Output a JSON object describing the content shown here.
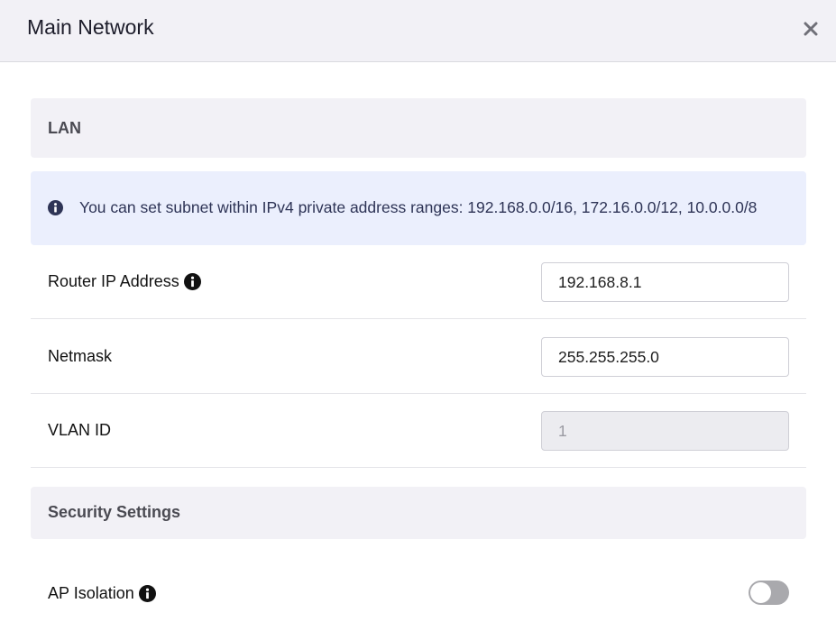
{
  "modal": {
    "title": "Main Network"
  },
  "sections": {
    "lan": {
      "title": "LAN"
    },
    "security": {
      "title": "Security Settings"
    }
  },
  "info_banner": {
    "text": "You can set subnet within IPv4 private address ranges: 192.168.0.0/16, 172.16.0.0/12, 10.0.0.0/8"
  },
  "fields": {
    "router_ip": {
      "label": "Router IP Address",
      "value": "192.168.8.1"
    },
    "netmask": {
      "label": "Netmask",
      "value": "255.255.255.0"
    },
    "vlan_id": {
      "label": "VLAN ID",
      "value": "1"
    },
    "ap_isolation": {
      "label": "AP Isolation",
      "enabled": false
    }
  },
  "colors": {
    "header_bg": "#f2f1f6",
    "banner_bg": "#ebeffd",
    "banner_icon": "#2e3456",
    "toggle_off": "#a9a9ad"
  },
  "icons": {
    "close": "close-icon",
    "info": "info-circle-icon"
  }
}
